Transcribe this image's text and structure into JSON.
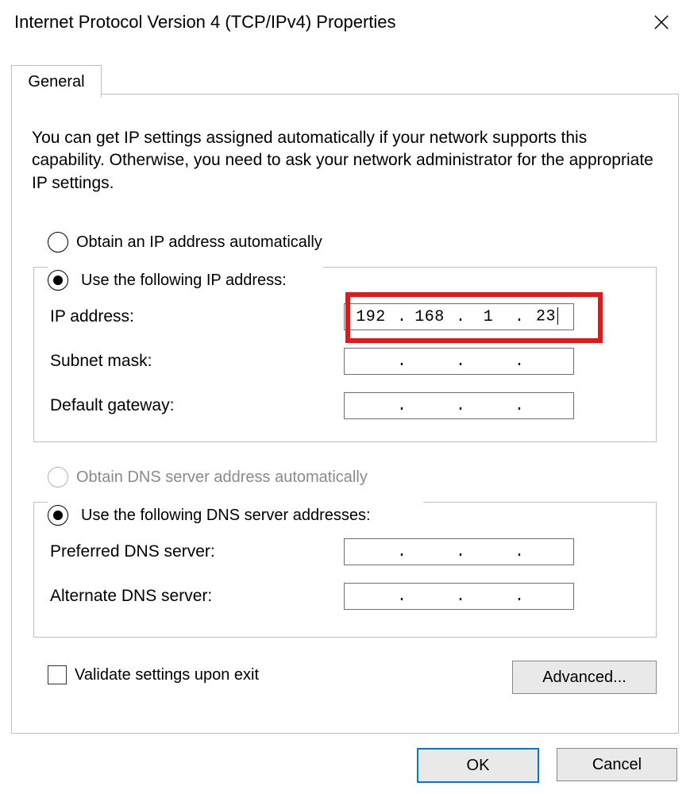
{
  "title": "Internet Protocol Version 4 (TCP/IPv4) Properties",
  "tab": "General",
  "intro": "You can get IP settings assigned automatically if your network supports this capability. Otherwise, you need to ask your network administrator for the appropriate IP settings.",
  "ip_section": {
    "radio_auto": "Obtain an IP address automatically",
    "radio_manual": "Use the following IP address:",
    "ip_label": "IP address:",
    "subnet_label": "Subnet mask:",
    "gateway_label": "Default gateway:",
    "ip_value": {
      "a": "192",
      "b": "168",
      "c": "1",
      "d": "23"
    },
    "subnet_value": {
      "a": "",
      "b": "",
      "c": "",
      "d": ""
    },
    "gateway_value": {
      "a": "",
      "b": "",
      "c": "",
      "d": ""
    }
  },
  "dns_section": {
    "radio_auto": "Obtain DNS server address automatically",
    "radio_manual": "Use the following DNS server addresses:",
    "pref_label": "Preferred DNS server:",
    "alt_label": "Alternate DNS server:",
    "pref_value": {
      "a": "",
      "b": "",
      "c": "",
      "d": ""
    },
    "alt_value": {
      "a": "",
      "b": "",
      "c": "",
      "d": ""
    }
  },
  "validate_label": "Validate settings upon exit",
  "advanced_label": "Advanced...",
  "ok_label": "OK",
  "cancel_label": "Cancel"
}
